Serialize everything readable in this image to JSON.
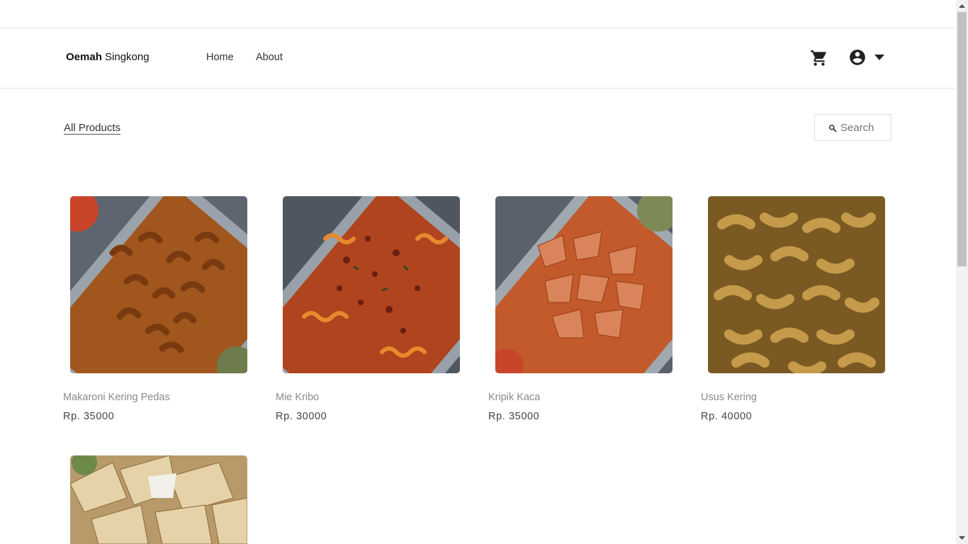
{
  "brand": {
    "bold": "Oemah",
    "rest": "Singkong"
  },
  "nav": {
    "home": "Home",
    "about": "About"
  },
  "icons": {
    "cart": "cart-icon",
    "account": "account-circle-icon",
    "caret": "caret-down-icon",
    "search": "search-icon"
  },
  "filter": {
    "label": "All Products"
  },
  "search": {
    "placeholder": "Search"
  },
  "products": [
    {
      "name": "Makaroni Kering Pedas",
      "price": "Rp. 35000"
    },
    {
      "name": "Mie Kribo",
      "price": "Rp. 30000"
    },
    {
      "name": "Kripik Kaca",
      "price": "Rp. 35000"
    },
    {
      "name": "Usus Kering",
      "price": "Rp. 40000"
    },
    {
      "name": "",
      "price": ""
    }
  ],
  "colors": {
    "text": "#222222",
    "muted": "#8a8a8a",
    "border": "#e5e5e5"
  }
}
